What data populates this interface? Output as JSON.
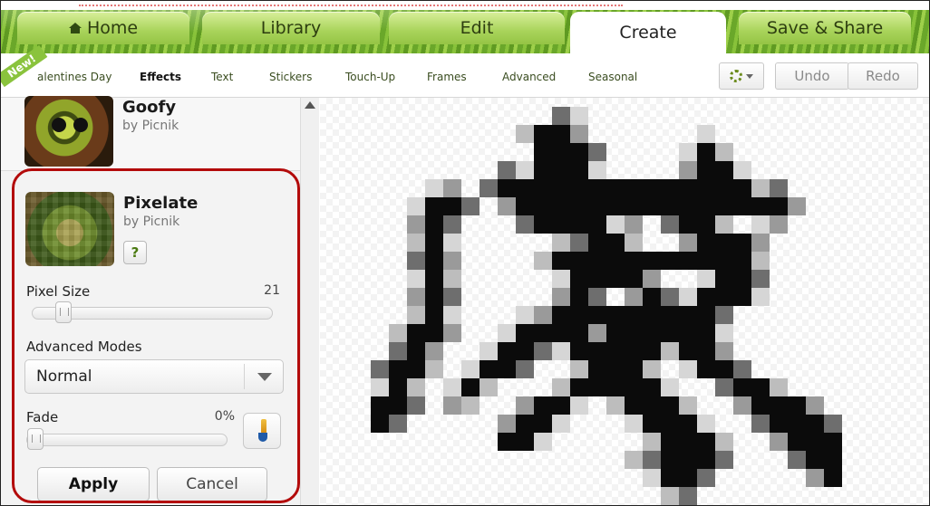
{
  "tabs": [
    {
      "label": "Home",
      "icon": "home-icon"
    },
    {
      "label": "Library"
    },
    {
      "label": "Edit"
    },
    {
      "label": "Create"
    },
    {
      "label": "Save & Share"
    }
  ],
  "subtabs": [
    {
      "label": "alentines Day"
    },
    {
      "label": "Effects"
    },
    {
      "label": "Text"
    },
    {
      "label": "Stickers"
    },
    {
      "label": "Touch-Up"
    },
    {
      "label": "Frames"
    },
    {
      "label": "Advanced"
    },
    {
      "label": "Seasonal"
    }
  ],
  "badge": {
    "new": "New!"
  },
  "toolbar": {
    "undo": "Undo",
    "redo": "Redo",
    "gear_icon": "gear-icon"
  },
  "effects": {
    "goofy": {
      "title": "Goofy",
      "by": "by Picnik"
    },
    "pixelate": {
      "title": "Pixelate",
      "by": "by Picnik",
      "help": "?"
    }
  },
  "controls": {
    "pixel_size": {
      "label": "Pixel Size",
      "value": "21",
      "level": 0.1
    },
    "advanced_modes": {
      "label": "Advanced Modes",
      "selected": "Normal"
    },
    "fade": {
      "label": "Fade",
      "value": "0%",
      "level": 0.0
    },
    "apply": "Apply",
    "cancel": "Cancel"
  },
  "colors": {
    "grass_green": "#88c23a",
    "highlight_red": "#b30b0b",
    "canvas_black": "#000000"
  }
}
